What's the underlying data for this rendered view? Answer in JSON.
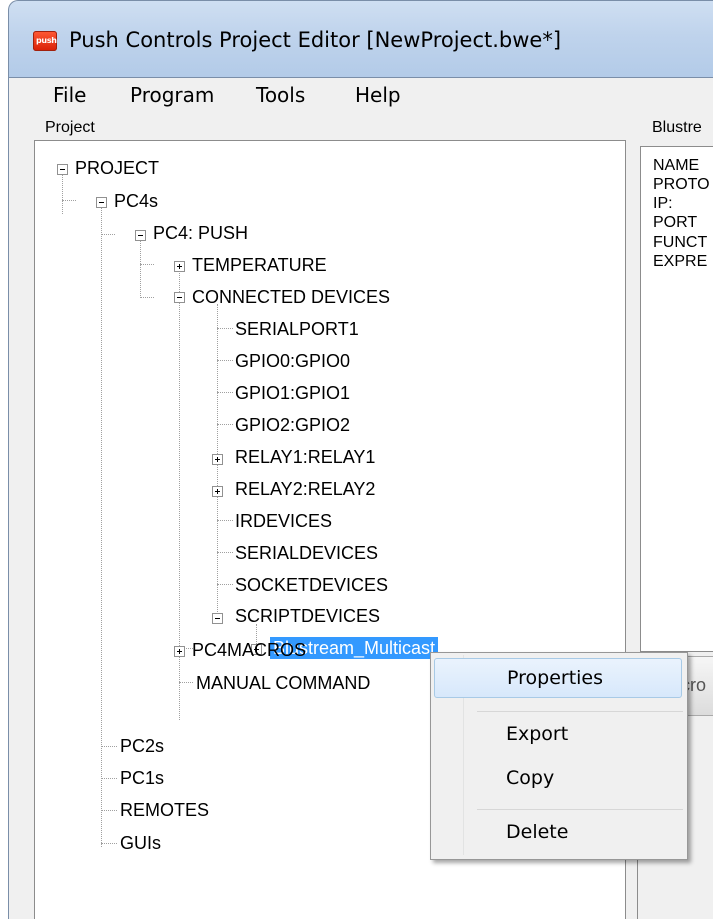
{
  "window": {
    "title": "Push Controls Project Editor [NewProject.bwe*]",
    "app_icon_text": "push"
  },
  "menu": [
    "File",
    "Program",
    "Tools",
    "Help"
  ],
  "project_panel": {
    "label": "Project",
    "tree": {
      "root": "PROJECT",
      "pc4s": "PC4s",
      "pc4_push": "PC4: PUSH",
      "temperature": "TEMPERATURE",
      "connected_devices": "CONNECTED DEVICES",
      "serialport1": "SERIALPORT1",
      "gpio0": "GPIO0:GPIO0",
      "gpio1": "GPIO1:GPIO1",
      "gpio2": "GPIO2:GPIO2",
      "relay1": "RELAY1:RELAY1",
      "relay2": "RELAY2:RELAY2",
      "irdevices": "IRDEVICES",
      "serialdevices": "SERIALDEVICES",
      "socketdevices": "SOCKETDEVICES",
      "scriptdevices": "SCRIPTDEVICES",
      "blustream": "Blustream_Multicast",
      "pc4macros": "PC4MACROS",
      "manual_command": "MANUAL COMMAND",
      "pc2s": "PC2s",
      "pc1s": "PC1s",
      "remotes": "REMOTES",
      "guis": "GUIs"
    }
  },
  "properties_panel": {
    "label": "Blustre",
    "fields": [
      "NAME",
      "PROTO",
      "IP:",
      "PORT",
      "FUNCT",
      "EXPRE"
    ],
    "button_fragment": "cro"
  },
  "context_menu": {
    "items": [
      "Properties",
      "Export",
      "Copy",
      "Delete"
    ],
    "highlighted": "Properties"
  }
}
